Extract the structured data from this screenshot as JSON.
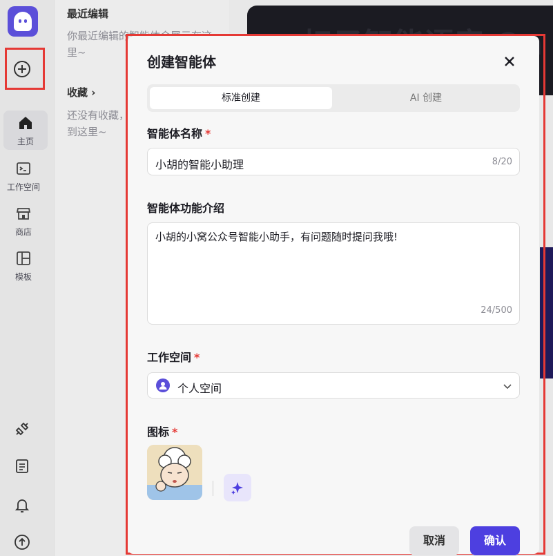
{
  "rail": {
    "items": [
      {
        "label": "主页",
        "icon": "home-icon"
      },
      {
        "label": "工作空间",
        "icon": "terminal-folder-icon"
      },
      {
        "label": "商店",
        "icon": "store-icon"
      },
      {
        "label": "模板",
        "icon": "template-icon"
      }
    ],
    "bottom_icons": [
      "plugin-icon",
      "document-icon",
      "bell-icon",
      "upload-arrow-icon"
    ]
  },
  "panel": {
    "recent_title": "最近编辑",
    "recent_empty": "你最近编辑的智能体会展示在这里~",
    "favorites_title": "收藏 ›",
    "favorites_empty": "还没有收藏，点击 ⭐ 按钮收藏到这里~"
  },
  "background": {
    "banner_text": "扣子智能语音 On"
  },
  "modal": {
    "title": "创建智能体",
    "tabs": [
      "标准创建",
      "AI 创建"
    ],
    "name_label": "智能体名称",
    "name_value": "小胡的智能小助理",
    "name_count": "8/20",
    "desc_label": "智能体功能介绍",
    "desc_value": "小胡的小窝公众号智能小助手，有问题随时提问我哦!",
    "desc_count": "24/500",
    "workspace_label": "工作空间",
    "workspace_value": "个人空间",
    "icon_label": "图标",
    "required_mark": "*",
    "cancel_label": "取消",
    "confirm_label": "确认"
  },
  "colors": {
    "accent": "#4d3fe0",
    "required": "#e53935",
    "highlight_outline": "#e53935"
  }
}
